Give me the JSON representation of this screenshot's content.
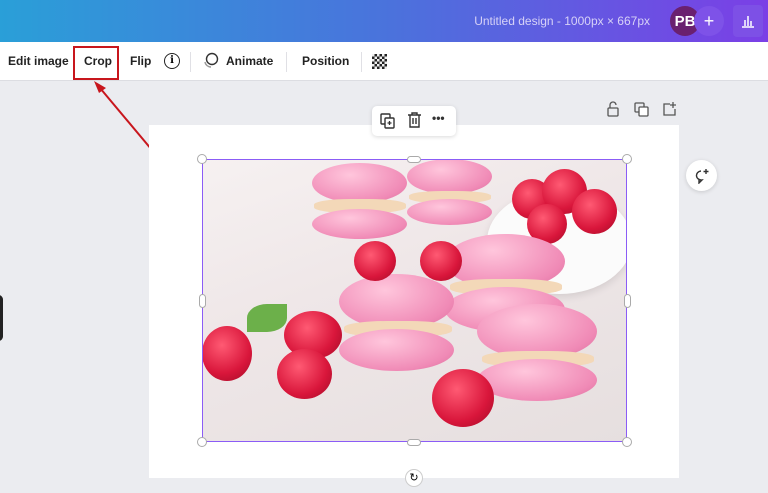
{
  "header": {
    "title": "Untitled design - 1000px × 667px",
    "avatar_initials": "PB",
    "add_label": "+",
    "gradient": [
      "#2a9fd8",
      "#7b3fe6"
    ]
  },
  "toolbar": {
    "edit_image": "Edit image",
    "crop": "Crop",
    "flip": "Flip",
    "info": "i",
    "animate": "Animate",
    "position": "Position"
  },
  "annotation": {
    "highlight_color": "#c8161d",
    "target": "Crop"
  },
  "floating_toolbar": {
    "more": "•••"
  },
  "canvas": {
    "image_subject": "pink macarons with raspberries",
    "selection_color": "#8b5cf6"
  }
}
